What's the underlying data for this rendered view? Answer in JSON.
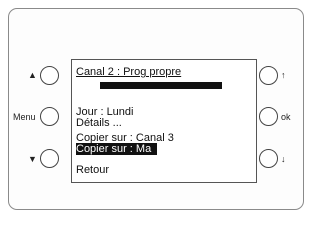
{
  "screen": {
    "title": "Canal 2 : Prog propre",
    "items": [
      "Jour : Lundi",
      "Détails ...",
      "Copier sur : Canal 3",
      "Copier sur : Ma",
      "Retour"
    ]
  },
  "buttons": {
    "left_top_icon": "triangle-up-icon",
    "left_mid_label": "Menu",
    "left_bottom_icon": "triangle-down-icon",
    "right_top_icon": "arrow-up-icon",
    "right_mid_label": "ok",
    "right_bottom_icon": "arrow-down-icon"
  }
}
